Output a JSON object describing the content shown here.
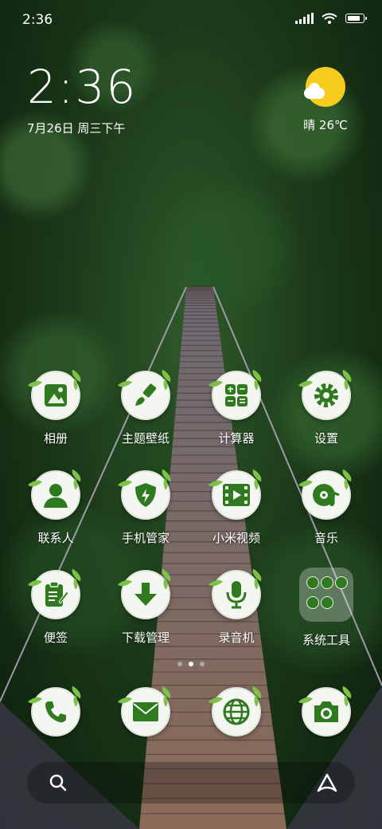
{
  "status_bar": {
    "time": "2:36"
  },
  "clock": {
    "time": "2:36",
    "date": "7月26日 周三下午"
  },
  "weather": {
    "text": "晴 26℃",
    "icon": "sunny-cloud-icon"
  },
  "apps": [
    {
      "label": "相册",
      "icon": "gallery-icon"
    },
    {
      "label": "主题壁纸",
      "icon": "theme-brush-icon"
    },
    {
      "label": "计算器",
      "icon": "calculator-icon"
    },
    {
      "label": "设置",
      "icon": "gear-icon"
    },
    {
      "label": "联系人",
      "icon": "contact-icon"
    },
    {
      "label": "手机管家",
      "icon": "security-shield-icon"
    },
    {
      "label": "小米视频",
      "icon": "video-icon"
    },
    {
      "label": "音乐",
      "icon": "music-icon"
    },
    {
      "label": "便签",
      "icon": "notes-icon"
    },
    {
      "label": "下载管理",
      "icon": "download-icon"
    },
    {
      "label": "录音机",
      "icon": "microphone-icon"
    },
    {
      "label": "系统工具",
      "icon": "folder-icon"
    }
  ],
  "dock": [
    {
      "icon": "phone-icon"
    },
    {
      "icon": "message-icon"
    },
    {
      "icon": "browser-icon"
    },
    {
      "icon": "camera-icon"
    }
  ],
  "pager": {
    "count": 3,
    "active_index": 1
  },
  "colors": {
    "icon_green": "#2f7a1e",
    "leaf_green": "#7cc247",
    "sun": "#f6cd1f"
  }
}
